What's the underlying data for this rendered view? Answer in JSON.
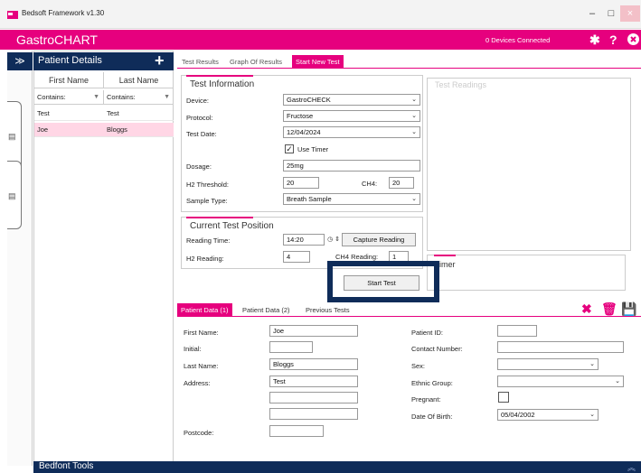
{
  "window": {
    "title": "Bedsoft Framework v1.30",
    "minimize": "–",
    "maximize": "□",
    "close": "×"
  },
  "header": {
    "app_name": "GastroCHART",
    "devices": "0 Devices Connected",
    "settings_icon": "gear-icon",
    "help_label": "?",
    "exit_icon": "close-circle-icon"
  },
  "sidebar": {
    "expand_label": "≫"
  },
  "patients": {
    "title": "Patient Details",
    "add_label": "+",
    "columns": [
      "First Name",
      "Last Name"
    ],
    "filters": [
      "Contains:",
      "Contains:"
    ],
    "rows": [
      {
        "first": "Test",
        "last": "Test",
        "selected": false
      },
      {
        "first": "Joe",
        "last": "Bloggs",
        "selected": true
      }
    ]
  },
  "tabs": [
    "Test Results",
    "Graph Of Results",
    "Start New Test"
  ],
  "test_info": {
    "title": "Test Information",
    "device_label": "Device:",
    "device_value": "GastroCHECK",
    "protocol_label": "Protocol:",
    "protocol_value": "Fructose",
    "date_label": "Test Date:",
    "date_value": "12/04/2024",
    "timer_label": "Use Timer",
    "timer_checked": "✓",
    "dosage_label": "Dosage:",
    "dosage_value": "25mg",
    "h2_label": "H2 Threshold:",
    "h2_value": "20",
    "ch4_label": "CH4:",
    "ch4_value": "20",
    "sample_label": "Sample Type:",
    "sample_value": "Breath Sample"
  },
  "position": {
    "title": "Current Test Position",
    "reading_time_label": "Reading Time:",
    "reading_time_value": "14:20",
    "capture_label": "Capture Reading",
    "h2_reading_label": "H2 Reading:",
    "h2_reading_value": "4",
    "ch4_reading_label": "CH4 Reading:",
    "ch4_reading_value": "1"
  },
  "start_test_label": "Start Test",
  "readings_title": "Test Readings",
  "timer_title": "imer",
  "lower_tabs": [
    "Patient Data (1)",
    "Patient Data (2)",
    "Previous Tests"
  ],
  "patient_form": {
    "first_name_label": "First Name:",
    "first_name": "Joe",
    "initial_label": "Initial:",
    "initial": "",
    "last_name_label": "Last Name:",
    "last_name": "Bloggs",
    "address_label": "Address:",
    "address1": "Test",
    "postcode_label": "Postcode:",
    "patient_id_label": "Patient ID:",
    "contact_label": "Contact Number:",
    "sex_label": "Sex:",
    "ethnic_label": "Ethnic Group:",
    "pregnant_label": "Pregnant:",
    "dob_label": "Date Of Birth:",
    "dob": "05/04/2002"
  },
  "footer": {
    "title": "Bedfont Tools",
    "collapse": "︽"
  },
  "colors": {
    "accent": "#e6007e",
    "navy": "#0f2c59",
    "selected_row": "#ffd6e5"
  }
}
